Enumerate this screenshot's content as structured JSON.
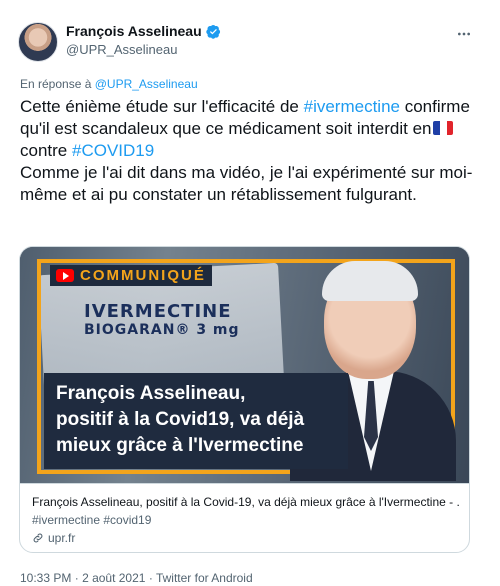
{
  "author": {
    "display_name": "François Asselineau",
    "handle": "@UPR_Asselineau",
    "verified": true
  },
  "reply": {
    "prefix": "En réponse à",
    "to": "@UPR_Asselineau"
  },
  "tweet": {
    "seg1": "Cette énième étude sur l'efficacité de ",
    "hashtag1": "#ivermectine",
    "seg2": " confirme qu'il est scandaleux que ce médicament soit interdit en",
    "flag": "france-flag-icon",
    "seg3": " contre ",
    "hashtag2": "#COVID19",
    "seg4": "Comme je l'ai dit dans ma vidéo, je l'ai expérimenté sur moi-même et ai pu constater un rétablissement fulgurant."
  },
  "card": {
    "image": {
      "badge": "COMMUNIQUÉ",
      "med_name": "IVERMECTINE",
      "med_sub": "BIOGARAN® 3 mg",
      "headline": [
        "François Asselineau,",
        "positif à la Covid19, va déjà",
        "mieux grâce à l'Ivermectine"
      ]
    },
    "title": "François Asselineau, positif à la Covid-19, va déjà mieux grâce à l'Ivermectine - ...",
    "description": "#ivermectine #covid19",
    "domain": "upr.fr"
  },
  "meta": {
    "time": "10:33 PM",
    "date": "2 août 2021",
    "source": "Twitter for Android",
    "separator": "·"
  },
  "colors": {
    "accent": "#1d9bf0",
    "text": "#0f1419",
    "secondary": "#536471",
    "frame": "#f3a41b"
  },
  "icons": {
    "verified": "verified-badge-icon",
    "more": "more-options-icon",
    "link": "link-icon",
    "play": "youtube-play-icon"
  }
}
